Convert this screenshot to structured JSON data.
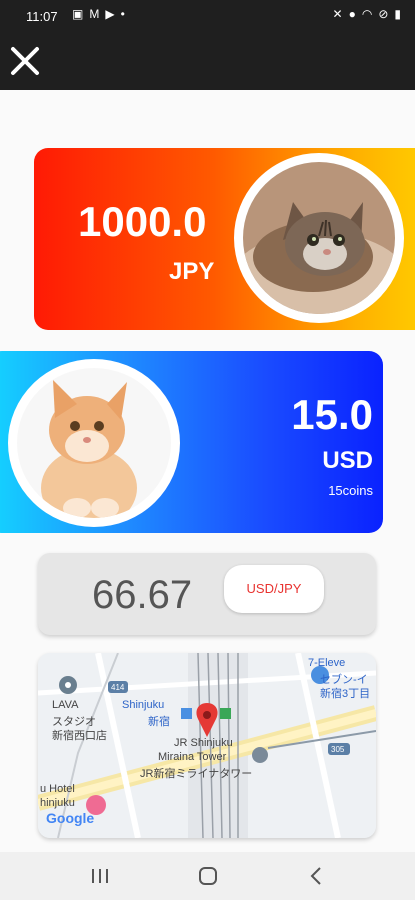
{
  "status_bar": {
    "time": "11:07",
    "notification_icons": [
      "image-icon",
      "gmail-icon",
      "play-icon",
      "dot-icon"
    ],
    "system_icons": [
      "mute-icon",
      "location-icon",
      "wifi-icon",
      "block-icon",
      "battery-icon"
    ]
  },
  "app_bar": {
    "close_icon": "close-icon"
  },
  "source_card": {
    "amount": "1000.0",
    "currency": "JPY",
    "image": "tabby-cat-photo"
  },
  "target_card": {
    "amount": "15.0",
    "currency": "USD",
    "coins": "15coins",
    "image": "orange-cat-photo"
  },
  "rate": {
    "value": "66.67",
    "pair_button": "USD/JPY"
  },
  "map": {
    "labels": {
      "seven_eleven": "7-Eleve",
      "seven_eleven_jp1": "セブン-イ",
      "seven_eleven_jp2": "新宿3丁目",
      "road_414": "414",
      "lava": "LAVA",
      "lava_jp1": "スタジオ",
      "lava_jp2": "新宿西口店",
      "shinjuku": "Shinjuku",
      "shinjuku_jp": "新宿",
      "jr_shinjuku": "JR Shinjuku",
      "miraina": "Miraina Tower",
      "miraina_jp": "JR新宿ミライナタワー",
      "road_305": "305",
      "hotel": "u Hotel",
      "shinjuku2": "hinjuku",
      "google": "Google"
    },
    "colors": {
      "pin": "#e53935",
      "transit": "#4a90e2"
    }
  },
  "nav_bar": {
    "icons": [
      "recents-icon",
      "home-icon",
      "back-icon"
    ]
  }
}
